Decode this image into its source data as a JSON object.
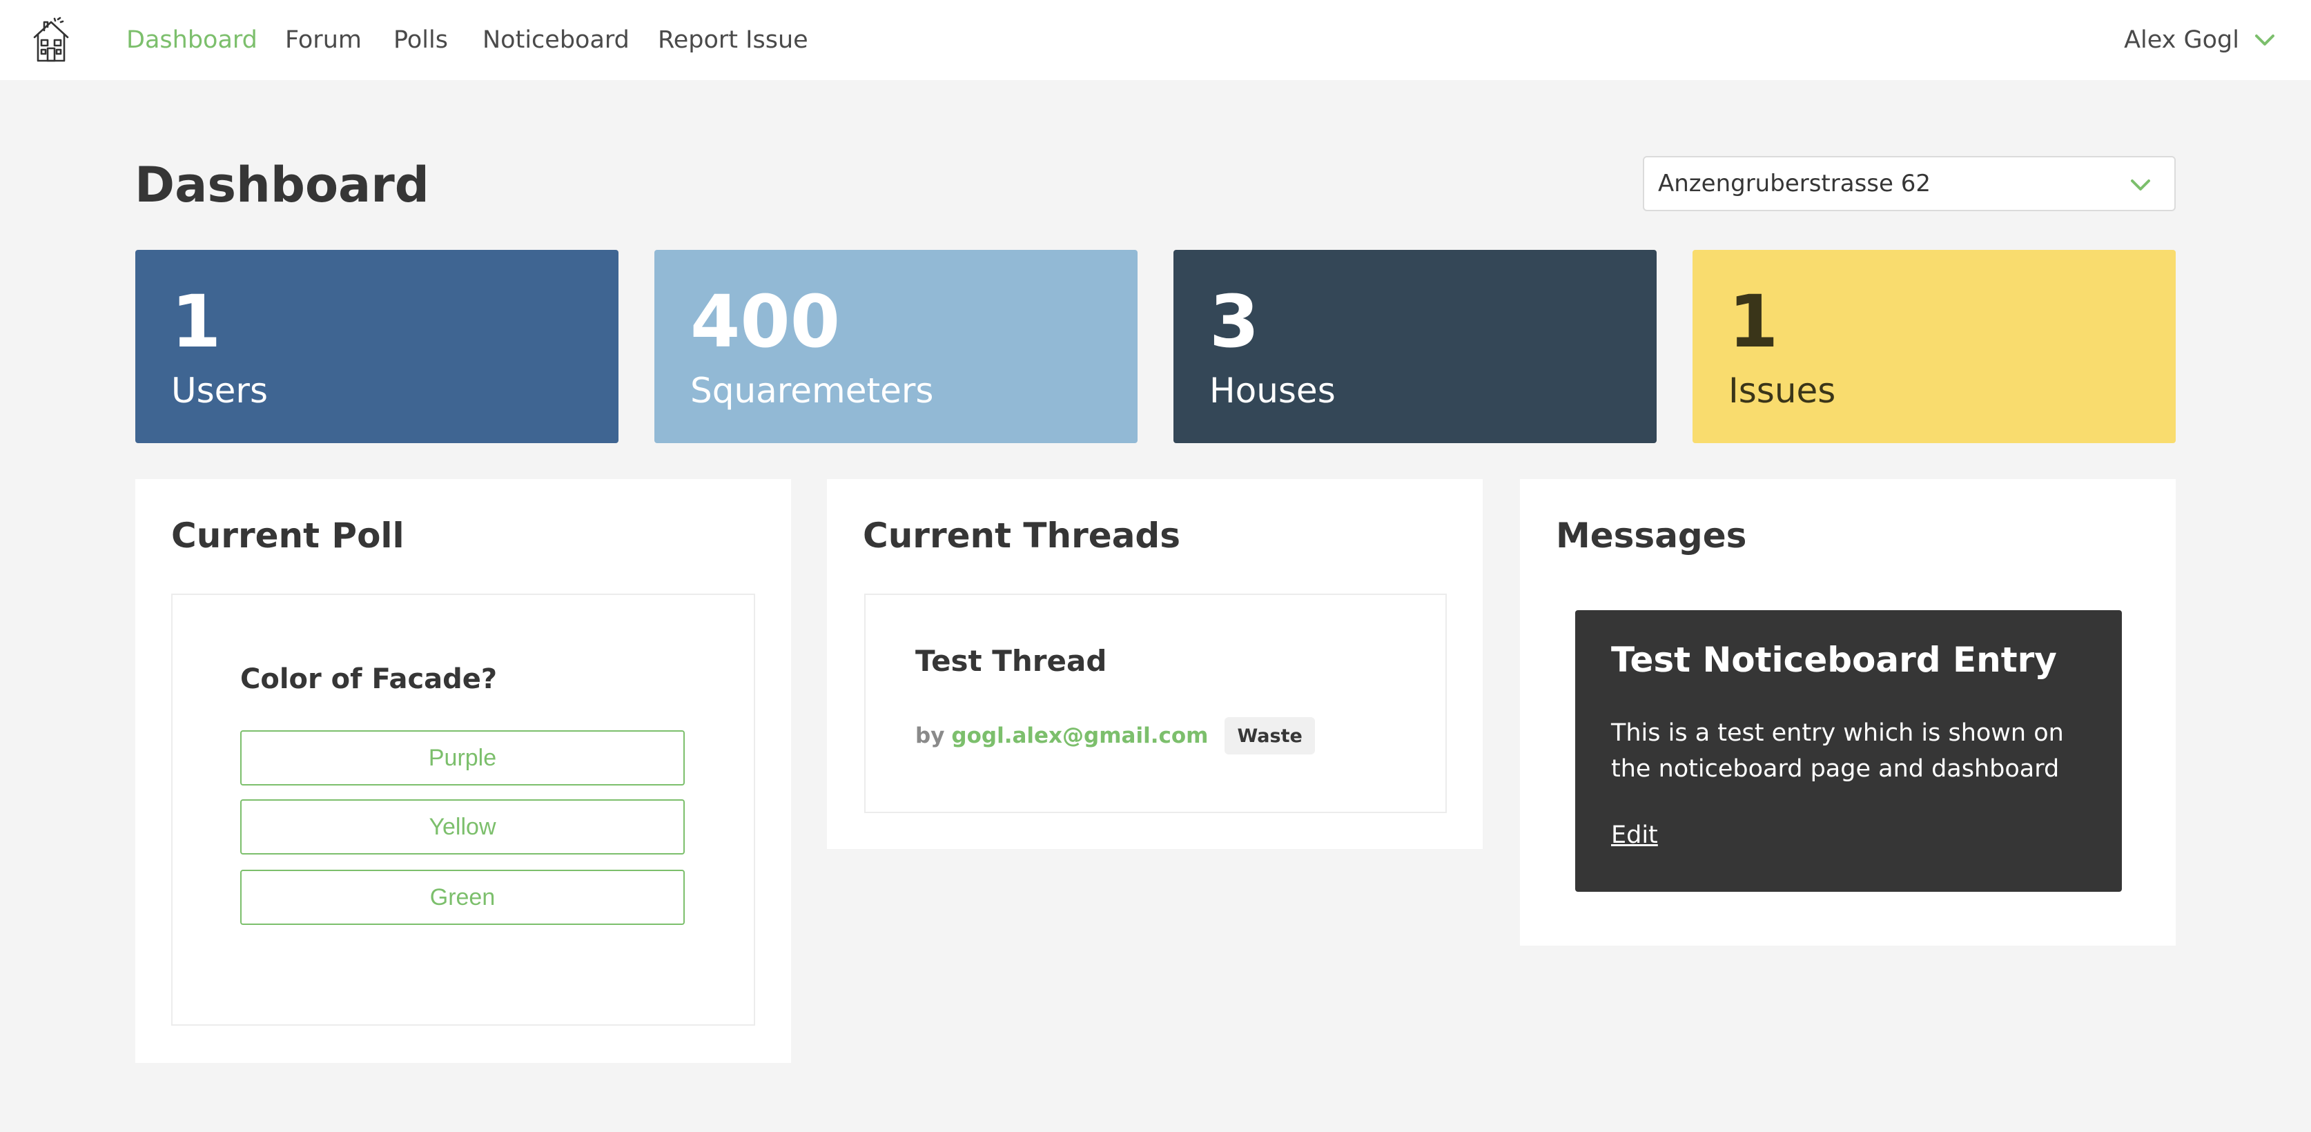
{
  "nav": {
    "logo": "house-logo-icon",
    "links": [
      "Dashboard",
      "Forum",
      "Polls",
      "Noticeboard",
      "Report Issue"
    ],
    "active": "Dashboard",
    "user_name": "Alex Gogl",
    "accent_color": "#7cbf6c"
  },
  "header": {
    "title": "Dashboard",
    "house_select": {
      "value": "Anzengruberstrasse 62"
    }
  },
  "stats": {
    "users": {
      "value": "1",
      "label": "Users",
      "color": "#3f6592"
    },
    "squaremeters": {
      "value": "400",
      "label": "Squaremeters",
      "color": "#92b9d5"
    },
    "houses": {
      "value": "3",
      "label": "Houses",
      "color": "#344757"
    },
    "issues": {
      "value": "1",
      "label": "Issues",
      "color": "#f9dc6e"
    }
  },
  "poll": {
    "title": "Current Poll",
    "question": "Color of Facade?",
    "options": [
      "Purple",
      "Yellow",
      "Green"
    ]
  },
  "threads": {
    "title": "Current Threads",
    "items": [
      {
        "title": "Test Thread",
        "by": "by",
        "author": "gogl.alex@gmail.com",
        "tag": "Waste"
      }
    ]
  },
  "messages": {
    "title": "Messages",
    "entries": [
      {
        "title": "Test Noticeboard Entry",
        "body": "This is a test entry which is shown on the noticeboard page and dashboard",
        "edit_label": "Edit"
      }
    ]
  }
}
